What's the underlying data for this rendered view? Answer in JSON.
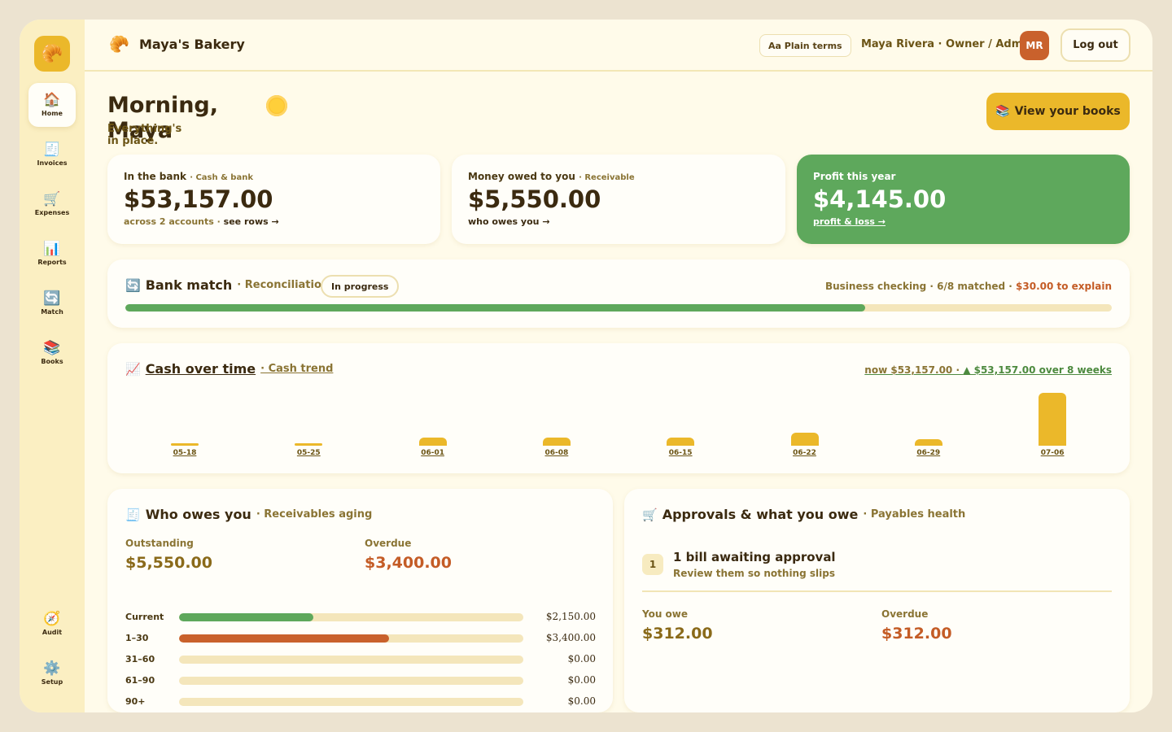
{
  "sidebar": {
    "logo_icon": "croissant-icon",
    "items": [
      {
        "label": "Home",
        "icon": "house-icon",
        "glyph": "🏠",
        "active": true
      },
      {
        "label": "Invoices",
        "icon": "invoice-icon",
        "glyph": "🧾"
      },
      {
        "label": "Expenses",
        "icon": "cart-icon",
        "glyph": "🛒"
      },
      {
        "label": "Reports",
        "icon": "bar-chart-icon",
        "glyph": "📊"
      },
      {
        "label": "Match",
        "icon": "sync-icon",
        "glyph": "🔄"
      },
      {
        "label": "Books",
        "icon": "books-icon",
        "glyph": "📚"
      },
      {
        "label": "Audit",
        "icon": "compass-icon",
        "glyph": "🧭"
      },
      {
        "label": "Setup",
        "icon": "gear-icon",
        "glyph": "⚙️"
      }
    ]
  },
  "header": {
    "brand_glyph": "🥐",
    "brand_name": "Maya's Bakery",
    "plain_terms": "Aa Plain terms",
    "user": "Maya Rivera · Owner / Admin",
    "avatar": "MR",
    "logout": "Log out"
  },
  "greeting": {
    "title": "Morning, Maya",
    "subtitle": "Everything's in place.",
    "view_books": "View your books",
    "view_books_glyph": "📚"
  },
  "kpis": {
    "bank": {
      "label": "In the bank",
      "sub": "· Cash & bank",
      "value": "$53,157.00",
      "link_pre": "across 2 accounts · ",
      "link": "see rows →"
    },
    "owed": {
      "label": "Money owed to you",
      "sub": "· Receivable",
      "value": "$5,550.00",
      "link": "who owes you →"
    },
    "profit": {
      "label": "Profit this year",
      "value": "$4,145.00",
      "link": "profit & loss →"
    }
  },
  "bank_match": {
    "glyph": "🔄",
    "title": "Bank match",
    "sub": "· Reconciliation",
    "status": "In progress",
    "detail": "Business checking · 6/8 matched · ",
    "warn": "$30.00 to explain",
    "progress": 0.75
  },
  "cash_trend": {
    "glyph": "📈",
    "title": "Cash over time",
    "sub": "· Cash trend",
    "summary_muted": "now $53,157.00 · ",
    "summary": "▲ $53,157.00 over 8 weeks"
  },
  "chart_data": {
    "type": "bar",
    "categories": [
      "05-18",
      "05-25",
      "06-01",
      "06-08",
      "06-15",
      "06-22",
      "06-29",
      "07-06"
    ],
    "values": [
      2,
      2,
      6,
      6,
      6,
      10,
      5,
      40
    ],
    "ylim": [
      0,
      40
    ],
    "note": "relative scale; only the final value is anchored"
  },
  "receivables": {
    "glyph": "🧾",
    "title": "Who owes you",
    "sub": "· Receivables aging",
    "outstanding_label": "Outstanding",
    "outstanding": "$5,550.00",
    "overdue_label": "Overdue",
    "overdue": "$3,400.00",
    "rows": [
      {
        "label": "Current",
        "amount": "$2,150.00",
        "fraction": 0.39,
        "color": "#5ea85c"
      },
      {
        "label": "1–30",
        "amount": "$3,400.00",
        "fraction": 0.61,
        "color": "#c9612c"
      },
      {
        "label": "31–60",
        "amount": "$0.00",
        "fraction": 0,
        "color": "#5ea85c"
      },
      {
        "label": "61–90",
        "amount": "$0.00",
        "fraction": 0,
        "color": "#5ea85c"
      },
      {
        "label": "90+",
        "amount": "$0.00",
        "fraction": 0,
        "color": "#5ea85c"
      }
    ]
  },
  "payables": {
    "glyph": "🛒",
    "title": "Approvals & what you owe",
    "sub": "· Payables health",
    "badge": "1",
    "approval_title": "1 bill awaiting approval",
    "approval_sub": "Review them so nothing slips",
    "owe_label": "You owe",
    "owe": "$312.00",
    "overdue_label": "Overdue",
    "overdue": "$312.00"
  },
  "colors": {
    "accent": "#ebb82a",
    "positive": "#5ea85c",
    "warning": "#c45c26"
  }
}
